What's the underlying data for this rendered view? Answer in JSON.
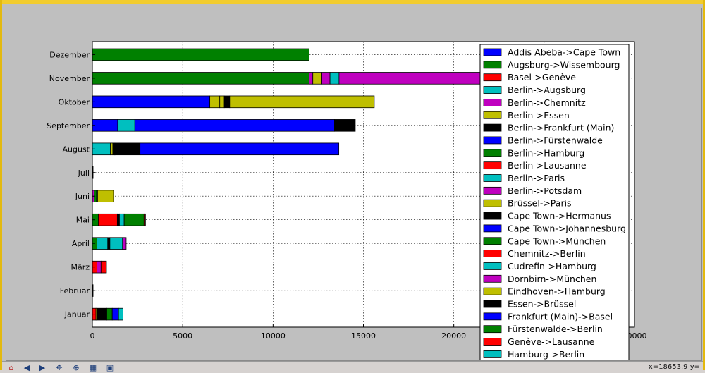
{
  "window": {
    "toolbar": {
      "icons": [
        "home-icon",
        "back-arrow-icon",
        "forward-arrow-icon",
        "pan-icon",
        "zoom-icon",
        "subplots-icon",
        "save-icon"
      ],
      "coordinate_readout": "x=18653.9     y="
    }
  },
  "colors": {
    "blue": "#0000ff",
    "green": "#008000",
    "red": "#ff0000",
    "cyan": "#00bfbf",
    "magenta": "#bf00bf",
    "olive": "#bfbf00",
    "black": "#000000"
  },
  "chart_data": {
    "type": "bar",
    "orientation": "horizontal",
    "stacked": true,
    "title": "",
    "xlabel": "",
    "ylabel": "",
    "xlim": [
      0,
      30000
    ],
    "xticks": [
      "0",
      "5000",
      "10000",
      "15000",
      "20000",
      "25000",
      "30000"
    ],
    "grid": true,
    "legend_position": "right-upper-overlapping",
    "categories": [
      "Januar",
      "Februar",
      "März",
      "April",
      "Mai",
      "Juni",
      "Juli",
      "August",
      "September",
      "Oktober",
      "November",
      "Dezember"
    ],
    "legend": [
      {
        "label": "Addis Abeba->Cape Town",
        "color": "#0000ff"
      },
      {
        "label": "Augsburg->Wissembourg",
        "color": "#008000"
      },
      {
        "label": "Basel->Genève",
        "color": "#ff0000"
      },
      {
        "label": "Berlin->Augsburg",
        "color": "#00bfbf"
      },
      {
        "label": "Berlin->Chemnitz",
        "color": "#bf00bf"
      },
      {
        "label": "Berlin->Essen",
        "color": "#bfbf00"
      },
      {
        "label": "Berlin->Frankfurt (Main)",
        "color": "#000000"
      },
      {
        "label": "Berlin->Fürstenwalde",
        "color": "#0000ff"
      },
      {
        "label": "Berlin->Hamburg",
        "color": "#008000"
      },
      {
        "label": "Berlin->Lausanne",
        "color": "#ff0000"
      },
      {
        "label": "Berlin->Paris",
        "color": "#00bfbf"
      },
      {
        "label": "Berlin->Potsdam",
        "color": "#bf00bf"
      },
      {
        "label": "Brüssel->Paris",
        "color": "#bfbf00"
      },
      {
        "label": "Cape Town->Hermanus",
        "color": "#000000"
      },
      {
        "label": "Cape Town->Johannesburg",
        "color": "#0000ff"
      },
      {
        "label": "Cape Town->München",
        "color": "#008000"
      },
      {
        "label": "Chemnitz->Berlin",
        "color": "#ff0000"
      },
      {
        "label": "Cudrefin->Hamburg",
        "color": "#00bfbf"
      },
      {
        "label": "Dornbirn->München",
        "color": "#bf00bf"
      },
      {
        "label": "Eindhoven->Hamburg",
        "color": "#bfbf00"
      },
      {
        "label": "Essen->Brüssel",
        "color": "#000000"
      },
      {
        "label": "Frankfurt (Main)->Basel",
        "color": "#0000ff"
      },
      {
        "label": "Fürstenwalde->Berlin",
        "color": "#008000"
      },
      {
        "label": "Genève->Lausanne",
        "color": "#ff0000"
      },
      {
        "label": "Hamburg->Berlin",
        "color": "#00bfbf"
      }
    ],
    "stacks": [
      {
        "month": "Januar",
        "segments": [
          {
            "value": 200,
            "color": "#ff0000"
          },
          {
            "value": 50,
            "color": "#bfbf00"
          },
          {
            "value": 550,
            "color": "#000000"
          },
          {
            "value": 300,
            "color": "#008000"
          },
          {
            "value": 350,
            "color": "#0000ff"
          },
          {
            "value": 250,
            "color": "#00bfbf"
          }
        ]
      },
      {
        "month": "Februar",
        "segments": [
          {
            "value": 40,
            "color": "#000000"
          }
        ]
      },
      {
        "month": "März",
        "segments": [
          {
            "value": 250,
            "color": "#ff0000"
          },
          {
            "value": 230,
            "color": "#bf00bf"
          },
          {
            "value": 300,
            "color": "#ff0000"
          }
        ]
      },
      {
        "month": "April",
        "segments": [
          {
            "value": 250,
            "color": "#008000"
          },
          {
            "value": 600,
            "color": "#00bfbf"
          },
          {
            "value": 120,
            "color": "#000000"
          },
          {
            "value": 700,
            "color": "#00bfbf"
          },
          {
            "value": 200,
            "color": "#bf00bf"
          }
        ]
      },
      {
        "month": "Mai",
        "segments": [
          {
            "value": 330,
            "color": "#008000"
          },
          {
            "value": 1050,
            "color": "#ff0000"
          },
          {
            "value": 120,
            "color": "#000000"
          },
          {
            "value": 260,
            "color": "#00bfbf"
          },
          {
            "value": 1100,
            "color": "#008000"
          },
          {
            "value": 80,
            "color": "#ff0000"
          }
        ]
      },
      {
        "month": "Juni",
        "segments": [
          {
            "value": 100,
            "color": "#bf00bf"
          },
          {
            "value": 130,
            "color": "#008000"
          },
          {
            "value": 60,
            "color": "#00bfbf"
          },
          {
            "value": 880,
            "color": "#bfbf00"
          }
        ]
      },
      {
        "month": "Juli",
        "segments": [
          {
            "value": 40,
            "color": "#000000"
          }
        ]
      },
      {
        "month": "August",
        "segments": [
          {
            "value": 1000,
            "color": "#00bfbf"
          },
          {
            "value": 130,
            "color": "#bfbf00"
          },
          {
            "value": 100,
            "color": "#000000"
          },
          {
            "value": 10,
            "color": "#bfbf00"
          },
          {
            "value": 1400,
            "color": "#000000"
          },
          {
            "value": 11000,
            "color": "#0000ff"
          }
        ]
      },
      {
        "month": "September",
        "segments": [
          {
            "value": 1400,
            "color": "#0000ff"
          },
          {
            "value": 950,
            "color": "#00bfbf"
          },
          {
            "value": 11050,
            "color": "#0000ff"
          },
          {
            "value": 1150,
            "color": "#000000"
          }
        ]
      },
      {
        "month": "Oktober",
        "segments": [
          {
            "value": 6500,
            "color": "#0000ff"
          },
          {
            "value": 550,
            "color": "#bfbf00"
          },
          {
            "value": 250,
            "color": "#bfbf00"
          },
          {
            "value": 300,
            "color": "#000000"
          },
          {
            "value": 8000,
            "color": "#bfbf00"
          }
        ]
      },
      {
        "month": "November",
        "segments": [
          {
            "value": 12000,
            "color": "#008000"
          },
          {
            "value": 200,
            "color": "#bf00bf"
          },
          {
            "value": 500,
            "color": "#bfbf00"
          },
          {
            "value": 450,
            "color": "#bf00bf"
          },
          {
            "value": 500,
            "color": "#00bfbf"
          },
          {
            "value": 8000,
            "color": "#bf00bf"
          }
        ]
      },
      {
        "month": "Dezember",
        "segments": [
          {
            "value": 12000,
            "color": "#008000"
          }
        ]
      }
    ]
  }
}
